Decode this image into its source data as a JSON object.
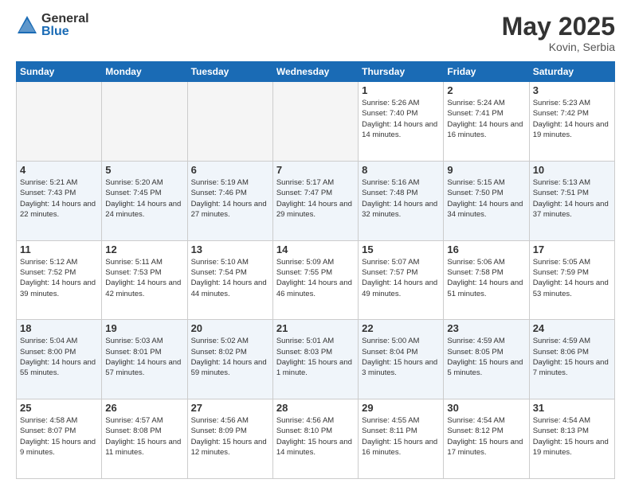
{
  "header": {
    "logo_general": "General",
    "logo_blue": "Blue",
    "month_title": "May 2025",
    "location": "Kovin, Serbia"
  },
  "days_of_week": [
    "Sunday",
    "Monday",
    "Tuesday",
    "Wednesday",
    "Thursday",
    "Friday",
    "Saturday"
  ],
  "weeks": [
    [
      {
        "day": "",
        "empty": true
      },
      {
        "day": "",
        "empty": true
      },
      {
        "day": "",
        "empty": true
      },
      {
        "day": "",
        "empty": true
      },
      {
        "day": "1",
        "sunrise": "5:26 AM",
        "sunset": "7:40 PM",
        "daylight": "14 hours and 14 minutes."
      },
      {
        "day": "2",
        "sunrise": "5:24 AM",
        "sunset": "7:41 PM",
        "daylight": "14 hours and 16 minutes."
      },
      {
        "day": "3",
        "sunrise": "5:23 AM",
        "sunset": "7:42 PM",
        "daylight": "14 hours and 19 minutes."
      }
    ],
    [
      {
        "day": "4",
        "sunrise": "5:21 AM",
        "sunset": "7:43 PM",
        "daylight": "14 hours and 22 minutes."
      },
      {
        "day": "5",
        "sunrise": "5:20 AM",
        "sunset": "7:45 PM",
        "daylight": "14 hours and 24 minutes."
      },
      {
        "day": "6",
        "sunrise": "5:19 AM",
        "sunset": "7:46 PM",
        "daylight": "14 hours and 27 minutes."
      },
      {
        "day": "7",
        "sunrise": "5:17 AM",
        "sunset": "7:47 PM",
        "daylight": "14 hours and 29 minutes."
      },
      {
        "day": "8",
        "sunrise": "5:16 AM",
        "sunset": "7:48 PM",
        "daylight": "14 hours and 32 minutes."
      },
      {
        "day": "9",
        "sunrise": "5:15 AM",
        "sunset": "7:50 PM",
        "daylight": "14 hours and 34 minutes."
      },
      {
        "day": "10",
        "sunrise": "5:13 AM",
        "sunset": "7:51 PM",
        "daylight": "14 hours and 37 minutes."
      }
    ],
    [
      {
        "day": "11",
        "sunrise": "5:12 AM",
        "sunset": "7:52 PM",
        "daylight": "14 hours and 39 minutes."
      },
      {
        "day": "12",
        "sunrise": "5:11 AM",
        "sunset": "7:53 PM",
        "daylight": "14 hours and 42 minutes."
      },
      {
        "day": "13",
        "sunrise": "5:10 AM",
        "sunset": "7:54 PM",
        "daylight": "14 hours and 44 minutes."
      },
      {
        "day": "14",
        "sunrise": "5:09 AM",
        "sunset": "7:55 PM",
        "daylight": "14 hours and 46 minutes."
      },
      {
        "day": "15",
        "sunrise": "5:07 AM",
        "sunset": "7:57 PM",
        "daylight": "14 hours and 49 minutes."
      },
      {
        "day": "16",
        "sunrise": "5:06 AM",
        "sunset": "7:58 PM",
        "daylight": "14 hours and 51 minutes."
      },
      {
        "day": "17",
        "sunrise": "5:05 AM",
        "sunset": "7:59 PM",
        "daylight": "14 hours and 53 minutes."
      }
    ],
    [
      {
        "day": "18",
        "sunrise": "5:04 AM",
        "sunset": "8:00 PM",
        "daylight": "14 hours and 55 minutes."
      },
      {
        "day": "19",
        "sunrise": "5:03 AM",
        "sunset": "8:01 PM",
        "daylight": "14 hours and 57 minutes."
      },
      {
        "day": "20",
        "sunrise": "5:02 AM",
        "sunset": "8:02 PM",
        "daylight": "14 hours and 59 minutes."
      },
      {
        "day": "21",
        "sunrise": "5:01 AM",
        "sunset": "8:03 PM",
        "daylight": "15 hours and 1 minute."
      },
      {
        "day": "22",
        "sunrise": "5:00 AM",
        "sunset": "8:04 PM",
        "daylight": "15 hours and 3 minutes."
      },
      {
        "day": "23",
        "sunrise": "4:59 AM",
        "sunset": "8:05 PM",
        "daylight": "15 hours and 5 minutes."
      },
      {
        "day": "24",
        "sunrise": "4:59 AM",
        "sunset": "8:06 PM",
        "daylight": "15 hours and 7 minutes."
      }
    ],
    [
      {
        "day": "25",
        "sunrise": "4:58 AM",
        "sunset": "8:07 PM",
        "daylight": "15 hours and 9 minutes."
      },
      {
        "day": "26",
        "sunrise": "4:57 AM",
        "sunset": "8:08 PM",
        "daylight": "15 hours and 11 minutes."
      },
      {
        "day": "27",
        "sunrise": "4:56 AM",
        "sunset": "8:09 PM",
        "daylight": "15 hours and 12 minutes."
      },
      {
        "day": "28",
        "sunrise": "4:56 AM",
        "sunset": "8:10 PM",
        "daylight": "15 hours and 14 minutes."
      },
      {
        "day": "29",
        "sunrise": "4:55 AM",
        "sunset": "8:11 PM",
        "daylight": "15 hours and 16 minutes."
      },
      {
        "day": "30",
        "sunrise": "4:54 AM",
        "sunset": "8:12 PM",
        "daylight": "15 hours and 17 minutes."
      },
      {
        "day": "31",
        "sunrise": "4:54 AM",
        "sunset": "8:13 PM",
        "daylight": "15 hours and 19 minutes."
      }
    ]
  ]
}
